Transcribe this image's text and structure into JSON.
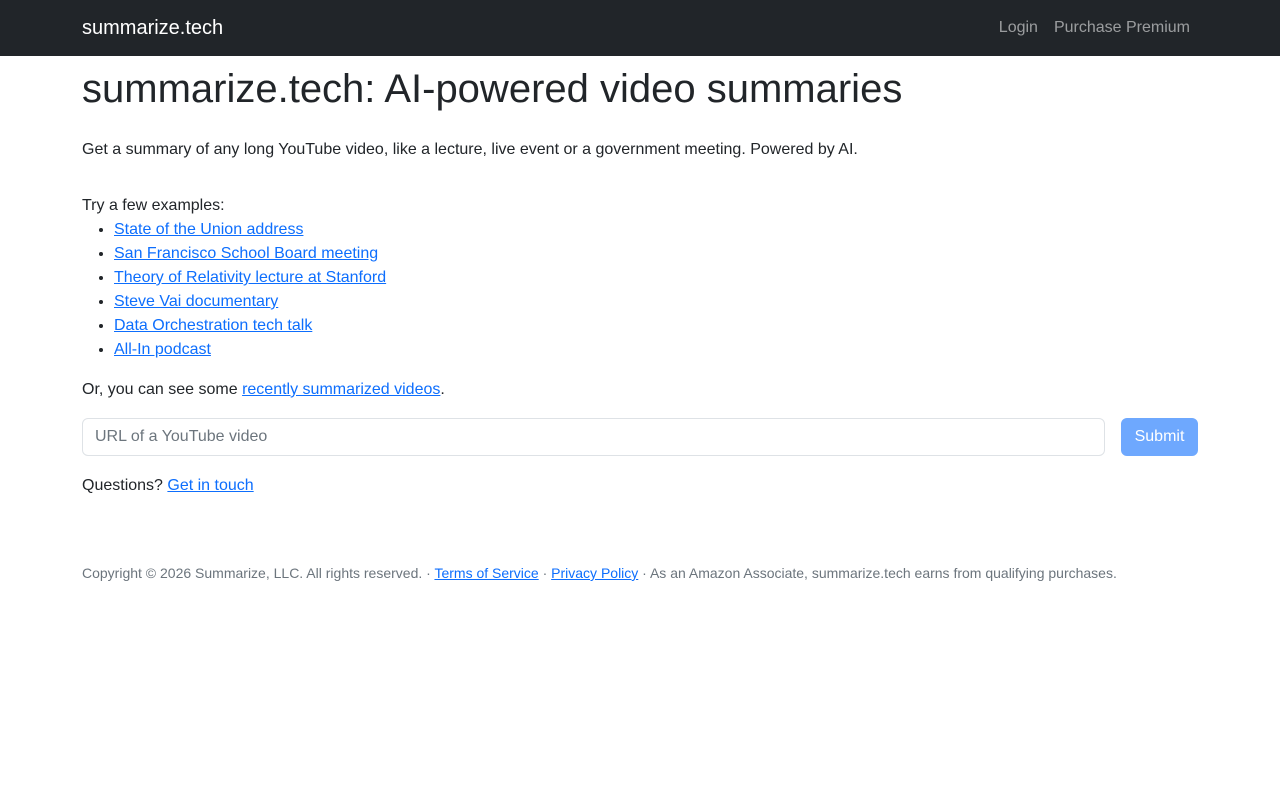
{
  "nav": {
    "brand": "summarize.tech",
    "login": "Login",
    "purchase": "Purchase Premium"
  },
  "main": {
    "title": "summarize.tech: AI-powered video summaries",
    "lead": "Get a summary of any long YouTube video, like a lecture, live event or a government meeting. Powered by AI.",
    "examples_intro": "Try a few examples:",
    "examples": [
      "State of the Union address",
      "San Francisco School Board meeting",
      "Theory of Relativity lecture at Stanford",
      "Steve Vai documentary",
      "Data Orchestration tech talk",
      "All-In podcast"
    ],
    "recent_prefix": "Or, you can see some ",
    "recent_link": "recently summarized videos",
    "recent_suffix": ".",
    "url_placeholder": "URL of a YouTube video",
    "submit_label": "Submit",
    "questions_prefix": "Questions? ",
    "questions_link": "Get in touch"
  },
  "footer": {
    "copyright": "Copyright © 2026 Summarize, LLC. All rights reserved.",
    "sep1": " · ",
    "terms": "Terms of Service",
    "sep2": " · ",
    "privacy": "Privacy Policy",
    "amazon": " · As an Amazon Associate, summarize.tech earns from qualifying purchases."
  },
  "colors": {
    "navbar_bg": "#212529",
    "link": "#0d6efd",
    "submit_bg": "#6ea8fe"
  }
}
